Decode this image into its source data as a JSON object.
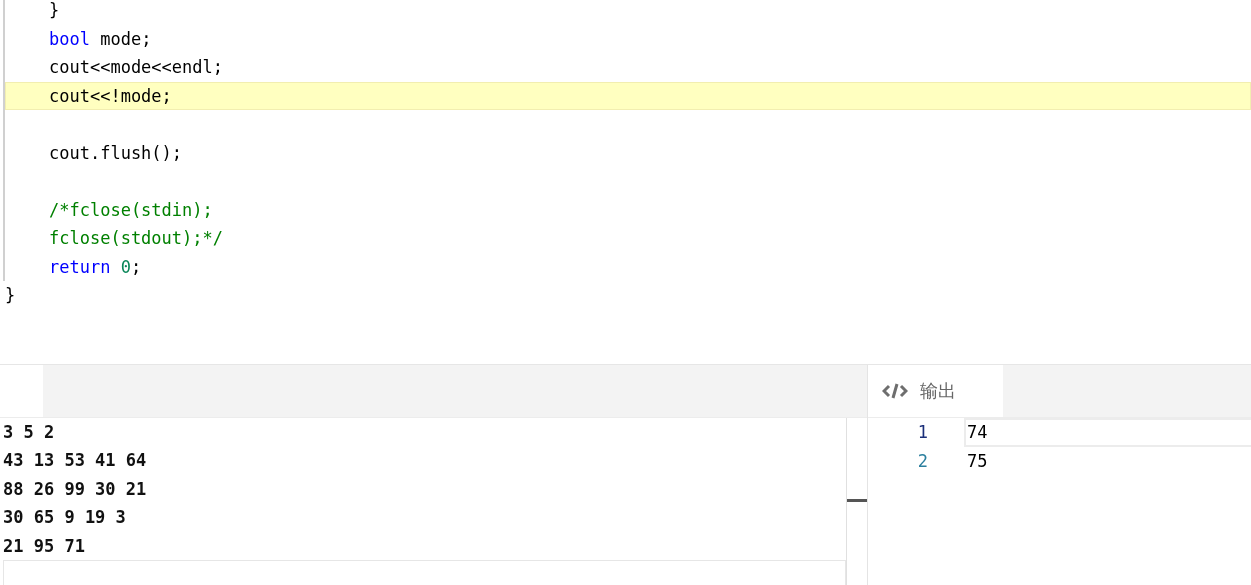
{
  "editor": {
    "lines": [
      {
        "indented": true,
        "highlighted": false,
        "tokens": [
          {
            "text": "}",
            "kind": "plain"
          }
        ]
      },
      {
        "indented": true,
        "highlighted": false,
        "tokens": [
          {
            "text": "bool",
            "kind": "keyword"
          },
          {
            "text": " mode;",
            "kind": "plain"
          }
        ]
      },
      {
        "indented": true,
        "highlighted": false,
        "tokens": [
          {
            "text": "cout<<mode<<endl;",
            "kind": "plain"
          }
        ]
      },
      {
        "indented": true,
        "highlighted": true,
        "tokens": [
          {
            "text": "cout<<!mode;",
            "kind": "plain"
          }
        ]
      },
      {
        "indented": true,
        "highlighted": false
      },
      {
        "indented": true,
        "highlighted": false,
        "tokens": [
          {
            "text": "cout.flush();",
            "kind": "plain"
          }
        ]
      },
      {
        "indented": true,
        "highlighted": false
      },
      {
        "indented": true,
        "highlighted": false,
        "tokens": [
          {
            "text": "/*fclose(stdin);",
            "kind": "comment"
          }
        ]
      },
      {
        "indented": true,
        "highlighted": false,
        "tokens": [
          {
            "text": "fclose(stdout);*/",
            "kind": "comment"
          }
        ]
      },
      {
        "indented": true,
        "highlighted": false,
        "tokens": [
          {
            "text": "return ",
            "kind": "keyword"
          },
          {
            "text": "0",
            "kind": "number"
          },
          {
            "text": ";",
            "kind": "plain"
          }
        ]
      },
      {
        "indented": false,
        "highlighted": false,
        "tokens": [
          {
            "text": "}",
            "kind": "plain"
          }
        ]
      }
    ]
  },
  "input_panel": {
    "tabs": [
      {
        "selected": true
      }
    ],
    "lines": [
      "3 5 2",
      "43 13 53 41 64",
      "88 26 99 30 21",
      "30 65 9 19 3",
      "21 95 71"
    ]
  },
  "output_panel": {
    "tabs": [
      {
        "label": "输出",
        "selected": true
      }
    ],
    "lines": [
      {
        "number": "1",
        "value": "74",
        "current": true
      },
      {
        "number": "2",
        "value": "75",
        "current": false
      }
    ]
  }
}
